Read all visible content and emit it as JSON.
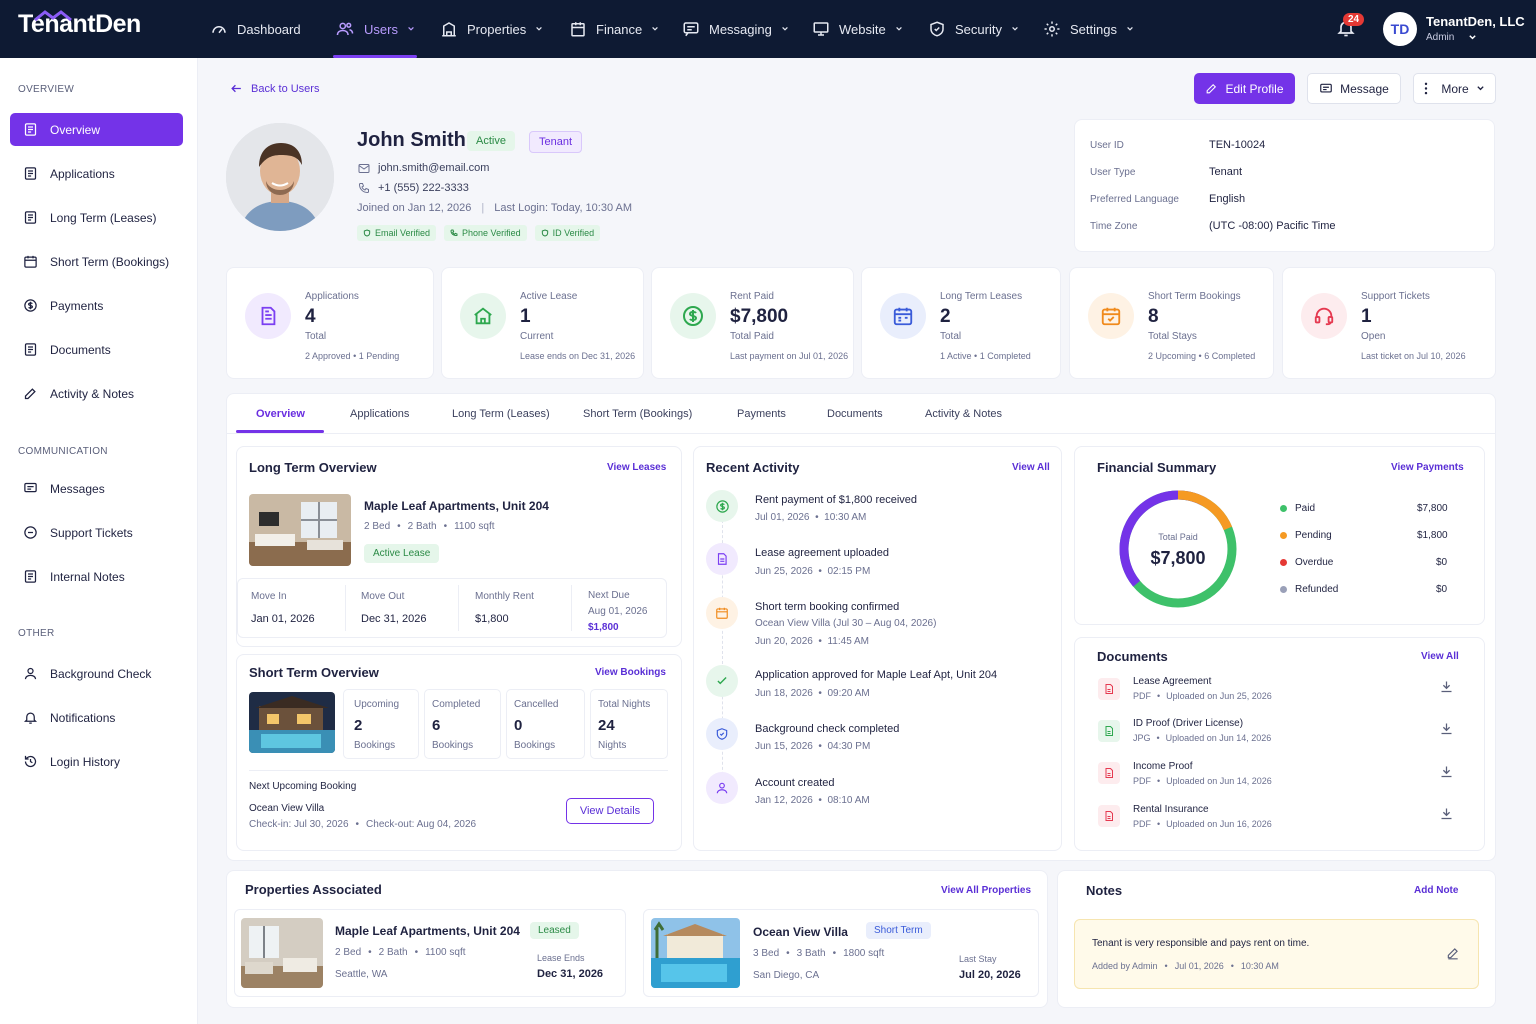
{
  "brand": {
    "name": "TenantDen",
    "logo_text": "TenantDen"
  },
  "nav": {
    "items": [
      {
        "label": "Dashboard"
      },
      {
        "label": "Users"
      },
      {
        "label": "Properties"
      },
      {
        "label": "Finance"
      },
      {
        "label": "Messaging"
      },
      {
        "label": "Website"
      },
      {
        "label": "Security"
      },
      {
        "label": "Settings"
      }
    ],
    "notifications": "24",
    "avatar_initials": "TD",
    "company": "TenantDen, LLC",
    "role": "Admin"
  },
  "sidebar": {
    "overview_heading": "OVERVIEW",
    "overview_items": [
      {
        "label": "Overview"
      },
      {
        "label": "Applications"
      },
      {
        "label": "Long Term (Leases)"
      },
      {
        "label": "Short Term (Bookings)"
      },
      {
        "label": "Payments"
      },
      {
        "label": "Documents"
      },
      {
        "label": "Activity & Notes"
      }
    ],
    "communication_heading": "COMMUNICATION",
    "communication_items": [
      {
        "label": "Messages"
      },
      {
        "label": "Support Tickets"
      },
      {
        "label": "Internal Notes"
      }
    ],
    "other_heading": "OTHER",
    "other_items": [
      {
        "label": "Background Check"
      },
      {
        "label": "Notifications"
      },
      {
        "label": "Login History"
      }
    ]
  },
  "header": {
    "back": "Back to Users",
    "edit_profile": "Edit Profile",
    "message": "Message",
    "more": "More"
  },
  "profile": {
    "name": "John Smith",
    "status": "Active",
    "type_badge": "Tenant",
    "email": "john.smith@email.com",
    "phone": "+1 (555) 222-3333",
    "joined": "Joined on Jan 12, 2026",
    "separator": "|",
    "last_login": "Last Login: Today, 10:30 AM",
    "verifications": [
      "Email Verified",
      "Phone Verified",
      "ID Verified"
    ]
  },
  "user_details": [
    {
      "label": "User ID",
      "value": "TEN-10024"
    },
    {
      "label": "User Type",
      "value": "Tenant"
    },
    {
      "label": "Preferred Language",
      "value": "English"
    },
    {
      "label": "Time Zone",
      "value": "(UTC -08:00) Pacific Time"
    }
  ],
  "stats": [
    {
      "label": "Applications",
      "value": "4",
      "sub": "Total",
      "foot_a": "2 Approved",
      "foot_b": "1 Pending",
      "icon": "file-icon",
      "color": "#7b3ff2",
      "bg": "#f1eafe"
    },
    {
      "label": "Active Lease",
      "value": "1",
      "sub": "Current",
      "foot_a": "Lease ends on Dec 31, 2026",
      "foot_b": "",
      "icon": "home-icon",
      "color": "#2ea84f",
      "bg": "#e7f6ec"
    },
    {
      "label": "Rent Paid",
      "value": "$7,800",
      "sub": "Total Paid",
      "foot_a": "Last payment on Jul 01, 2026",
      "foot_b": "",
      "icon": "dollar-icon",
      "color": "#2ea84f",
      "bg": "#e7f6ec"
    },
    {
      "label": "Long Term Leases",
      "value": "2",
      "sub": "Total",
      "foot_a": "1 Active",
      "foot_b": "1 Completed",
      "icon": "calendar-icon",
      "color": "#3a5bd9",
      "bg": "#e9eefc"
    },
    {
      "label": "Short Term Bookings",
      "value": "8",
      "sub": "Total Stays",
      "foot_a": "2 Upcoming",
      "foot_b": "6 Completed",
      "icon": "calendar-check-icon",
      "color": "#f08a1c",
      "bg": "#fef2e4"
    },
    {
      "label": "Support Tickets",
      "value": "1",
      "sub": "Open",
      "foot_a": "Last ticket on Jul 10, 2026",
      "foot_b": "",
      "icon": "headset-icon",
      "color": "#e53950",
      "bg": "#fdecee"
    }
  ],
  "tabs": [
    "Overview",
    "Applications",
    "Long Term (Leases)",
    "Short Term (Bookings)",
    "Payments",
    "Documents",
    "Activity & Notes"
  ],
  "long_term": {
    "title": "Long Term Overview",
    "link": "View Leases",
    "property": "Maple Leaf Apartments, Unit 204",
    "beds": "2 Bed",
    "baths": "2 Bath",
    "sqft": "1100 sqft",
    "badge": "Active Lease",
    "move_in_label": "Move In",
    "move_in": "Jan 01, 2026",
    "move_out_label": "Move Out",
    "move_out": "Dec 31, 2026",
    "rent_label": "Monthly Rent",
    "rent": "$1,800",
    "next_due_label": "Next Due",
    "next_due": "Aug 01, 2026",
    "next_due_amount": "$1,800"
  },
  "short_term": {
    "title": "Short Term Overview",
    "link": "View Bookings",
    "stats": [
      {
        "label": "Upcoming",
        "value": "2",
        "sub": "Bookings"
      },
      {
        "label": "Completed",
        "value": "6",
        "sub": "Bookings"
      },
      {
        "label": "Cancelled",
        "value": "0",
        "sub": "Bookings"
      },
      {
        "label": "Total Nights",
        "value": "24",
        "sub": "Nights"
      }
    ],
    "next_label": "Next Upcoming Booking",
    "next_property": "Ocean View Villa",
    "checkin": "Check-in: Jul 30, 2026",
    "checkout": "Check-out: Aug 04, 2026",
    "button": "View Details"
  },
  "activity": {
    "title": "Recent Activity",
    "link": "View All",
    "items": [
      {
        "title": "Rent payment of $1,800 received",
        "detail": "",
        "date": "Jul 01, 2026",
        "time": "10:30 AM",
        "icon": "dollar-icon",
        "color": "#2ea84f",
        "bg": "#e7f6ec"
      },
      {
        "title": "Lease agreement uploaded",
        "detail": "",
        "date": "Jun 25, 2026",
        "time": "02:15 PM",
        "icon": "file-icon",
        "color": "#7b3ff2",
        "bg": "#f1eafe"
      },
      {
        "title": "Short term booking confirmed",
        "detail": "Ocean View Villa (Jul 30 – Aug 04, 2026)",
        "date": "Jun 20, 2026",
        "time": "11:45 AM",
        "icon": "calendar-icon",
        "color": "#f08a1c",
        "bg": "#fef2e4"
      },
      {
        "title": "Application approved for Maple Leaf Apt, Unit 204",
        "detail": "",
        "date": "Jun 18, 2026",
        "time": "09:20 AM",
        "icon": "check-icon",
        "color": "#2ea84f",
        "bg": "#e7f6ec"
      },
      {
        "title": "Background check completed",
        "detail": "",
        "date": "Jun 15, 2026",
        "time": "04:30 PM",
        "icon": "shield-icon",
        "color": "#3a5bd9",
        "bg": "#e9eefc"
      },
      {
        "title": "Account created",
        "detail": "",
        "date": "Jan 12, 2026",
        "time": "08:10 AM",
        "icon": "user-icon",
        "color": "#7b3ff2",
        "bg": "#f1eafe"
      }
    ]
  },
  "financial": {
    "title": "Financial Summary",
    "link": "View Payments",
    "center_label": "Total Paid",
    "center_value": "$7,800",
    "legend": [
      {
        "label": "Paid",
        "value": "$7,800",
        "amount": 7800,
        "color": "#3ec16a"
      },
      {
        "label": "Pending",
        "value": "$1,800",
        "amount": 1800,
        "color": "#f59a23"
      },
      {
        "label": "Overdue",
        "value": "$0",
        "amount": 0,
        "color": "#e53935"
      },
      {
        "label": "Refunded",
        "value": "$0",
        "amount": 0,
        "color": "#9aa0b8"
      }
    ]
  },
  "documents": {
    "title": "Documents",
    "link": "View All",
    "items": [
      {
        "name": "Lease Agreement",
        "type": "PDF",
        "uploaded": "Uploaded on Jun 25, 2026",
        "color": "#e53950",
        "bg": "#fdecee"
      },
      {
        "name": "ID Proof (Driver License)",
        "type": "JPG",
        "uploaded": "Uploaded on Jun 14, 2026",
        "color": "#2ea84f",
        "bg": "#e7f6ec"
      },
      {
        "name": "Income Proof",
        "type": "PDF",
        "uploaded": "Uploaded on Jun 14, 2026",
        "color": "#e53950",
        "bg": "#fdecee"
      },
      {
        "name": "Rental Insurance",
        "type": "PDF",
        "uploaded": "Uploaded on Jun 16, 2026",
        "color": "#e53950",
        "bg": "#fdecee"
      }
    ]
  },
  "properties": {
    "title": "Properties Associated",
    "link": "View All Properties",
    "items": [
      {
        "name": "Maple Leaf Apartments, Unit 204",
        "badge": "Leased",
        "beds": "2 Bed",
        "baths": "2 Bath",
        "sqft": "1100 sqft",
        "location": "Seattle, WA",
        "date_label": "Lease Ends",
        "date": "Dec 31, 2026"
      },
      {
        "name": "Ocean View Villa",
        "badge": "Short Term",
        "beds": "3 Bed",
        "baths": "3 Bath",
        "sqft": "1800 sqft",
        "location": "San Diego, CA",
        "date_label": "Last Stay",
        "date": "Jul 20, 2026"
      }
    ]
  },
  "notes": {
    "title": "Notes",
    "link": "Add Note",
    "text": "Tenant is very responsible and pays rent on time.",
    "added_by": "Added by Admin",
    "date": "Jul 01, 2026",
    "time": "10:30 AM"
  },
  "dot": "•"
}
